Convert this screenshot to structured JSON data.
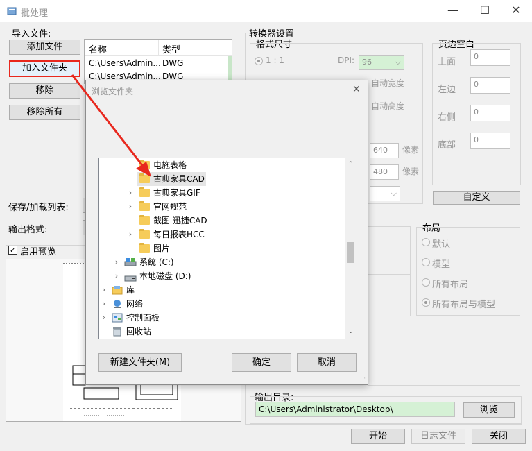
{
  "window": {
    "title": "批处理",
    "minimize": "—",
    "maximize": "☐",
    "close": "✕"
  },
  "import": {
    "group_label": "导入文件:",
    "add_file": "添加文件",
    "add_folder": "加入文件夹",
    "remove": "移除",
    "remove_all": "移除所有",
    "save_load_label": "保存/加载列表:",
    "output_format_label": "输出格式:",
    "preview_label": "启用预览",
    "preview_checked": true
  },
  "file_list": {
    "columns": [
      "名称",
      "类型"
    ],
    "rows": [
      {
        "name": "C:\\Users\\Admin...",
        "type": "DWG"
      },
      {
        "name": "C:\\Users\\Admin...",
        "type": "DWG"
      }
    ]
  },
  "converter": {
    "group_label": "转换器设置",
    "format_size_label": "格式尺寸",
    "ratio_label": "1 : 1",
    "dpi_label": "DPI:",
    "dpi_value": "96",
    "width_frag": "宽度",
    "pixel_frag": "像素",
    "auto_width": "自动宽度",
    "auto_height": "自动高度",
    "w_value": "640",
    "h_value": "480",
    "pixel_label_1": "像素",
    "pixel_label_2": "像素"
  },
  "margins": {
    "group_label": "页边空白",
    "top_label": "上面",
    "top_value": "0",
    "left_label": "左边",
    "left_value": "0",
    "right_label": "右侧",
    "right_value": "0",
    "bottom_label": "底部",
    "bottom_value": "0",
    "custom_button": "自定义"
  },
  "layout": {
    "group_label": "布局",
    "options": [
      "默认",
      "模型",
      "所有布局",
      "所有布局与模型"
    ],
    "selected": "所有布局与模型"
  },
  "output": {
    "dir_label": "输出目录:",
    "dir_value": "C:\\Users\\Administrator\\Desktop\\",
    "browse": "浏览"
  },
  "bottom_buttons": {
    "start": "开始",
    "log": "日志文件",
    "close": "关闭"
  },
  "browse_dialog": {
    "title": "浏览文件夹",
    "close": "✕",
    "new_folder": "新建文件夹(M)",
    "ok": "确定",
    "cancel": "取消",
    "tree": [
      {
        "label": "电施表格",
        "icon": "folder-icon",
        "expandable": false,
        "selected": false
      },
      {
        "label": "古典家具CAD",
        "icon": "folder-icon",
        "expandable": false,
        "selected": true
      },
      {
        "label": "古典家具GIF",
        "icon": "folder-icon",
        "expandable": true,
        "selected": false
      },
      {
        "label": "官网规范",
        "icon": "folder-icon",
        "expandable": true,
        "selected": false
      },
      {
        "label": "截图 迅捷CAD",
        "icon": "folder-icon",
        "expandable": false,
        "selected": false
      },
      {
        "label": "每日报表HCC",
        "icon": "folder-icon",
        "expandable": true,
        "selected": false
      },
      {
        "label": "图片",
        "icon": "folder-icon",
        "expandable": false,
        "selected": false
      },
      {
        "label": "系统 (C:)",
        "icon": "drive-icon",
        "expandable": true,
        "selected": false
      },
      {
        "label": "本地磁盘 (D:)",
        "icon": "drive-icon",
        "expandable": true,
        "selected": false
      },
      {
        "label": "库",
        "icon": "library-icon",
        "expandable": true,
        "selected": false
      },
      {
        "label": "网络",
        "icon": "network-icon",
        "expandable": true,
        "selected": false
      },
      {
        "label": "控制面板",
        "icon": "control-panel-icon",
        "expandable": true,
        "selected": false
      },
      {
        "label": "回收站",
        "icon": "recycle-bin-icon",
        "expandable": false,
        "selected": false
      }
    ]
  },
  "colors": {
    "highlight_red": "#e8281e",
    "field_green": "#d5f1d5",
    "selection": "#e5e5e5"
  }
}
